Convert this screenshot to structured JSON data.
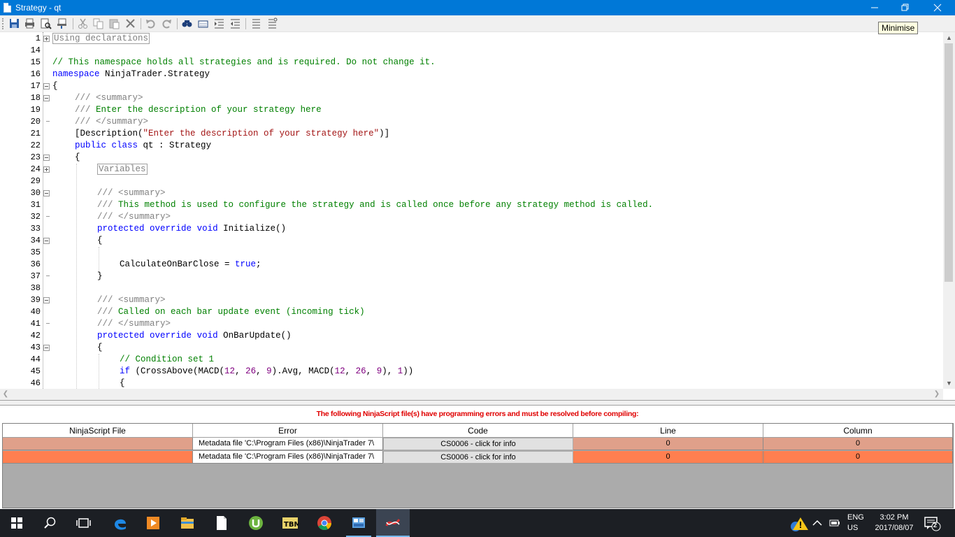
{
  "window": {
    "title": "Strategy - qt"
  },
  "tooltip": "Minimise",
  "toolbar": {
    "icons": [
      "save-icon",
      "print-icon",
      "print-preview-icon",
      "page-setup-icon",
      "cut-icon",
      "copy-icon",
      "paste-icon",
      "delete-icon",
      "undo-icon",
      "redo-icon",
      "find-icon",
      "replace-icon",
      "indent-icon",
      "outdent-icon",
      "comment-icon",
      "uncomment-icon"
    ]
  },
  "editor": {
    "line_numbers": [
      "1",
      "14",
      "15",
      "16",
      "17",
      "18",
      "19",
      "20",
      "21",
      "22",
      "23",
      "24",
      "29",
      "30",
      "31",
      "32",
      "33",
      "34",
      "35",
      "36",
      "37",
      "38",
      "39",
      "40",
      "41",
      "42",
      "43",
      "44",
      "45",
      "46"
    ],
    "region_using": "Using declarations",
    "region_variables": "Variables",
    "line15": "// This namespace holds all strategies and is required. Do not change it.",
    "kw_namespace": "namespace",
    "ns_name": " NinjaTrader.Strategy",
    "brace_open": "{",
    "brace_close": "}",
    "doc_summary_open": "/// <summary>",
    "doc_slashes": "/// ",
    "line19_text": "Enter the description of your strategy here",
    "doc_summary_close": "/// </summary>",
    "line21_a": "[Description(",
    "line21_str": "\"Enter the description of your strategy here\"",
    "line21_b": ")]",
    "kw_public": "public",
    "kw_class": "class",
    "class_decl": " qt : Strategy",
    "line31_text": "This method is used to configure the strategy and is called once before any strategy method is called.",
    "kw_protected": "protected",
    "kw_override": "override",
    "kw_void": "void",
    "method_init": " Initialize()",
    "line36_a": "CalculateOnBarClose = ",
    "kw_true": "true",
    "semicolon": ";",
    "line40_text": "Called on each bar update event (incoming tick)",
    "method_update": " OnBarUpdate()",
    "line44": "// Condition set 1",
    "kw_if": "if",
    "line45_a": " (CrossAbove(MACD(",
    "n12": "12",
    "n26": "26",
    "n9": "9",
    "n1": "1",
    "comma": ", ",
    "line45_b": ").Avg, MACD(",
    "close_paren": ")",
    "line45_end": "))"
  },
  "errors": {
    "message": "The following NinjaScript file(s) have programming errors and must be resolved before compiling:",
    "columns": [
      "NinjaScript File",
      "Error",
      "Code",
      "Line",
      "Column"
    ],
    "rows": [
      {
        "file": "",
        "error": "Metadata file 'C:\\Program Files (x86)\\NinjaTrader 7\\",
        "code": "CS0006 - click for info",
        "line": "0",
        "column": "0",
        "color": "#e0a08a"
      },
      {
        "file": "",
        "error": "Metadata file 'C:\\Program Files (x86)\\NinjaTrader 7\\",
        "code": "CS0006 - click for info",
        "line": "0",
        "column": "0",
        "color": "#ff7f50"
      }
    ]
  },
  "taskbar": {
    "apps": [
      "start-icon",
      "search-icon",
      "task-view-icon",
      "edge-icon",
      "media-player-icon",
      "file-explorer-icon",
      "document-icon",
      "utorrent-icon",
      "tbm-icon",
      "chrome-icon",
      "control-panel-icon",
      "ninjatrader-icon"
    ],
    "lang_1": "ENG",
    "lang_2": "US",
    "time": "3:02 PM",
    "date": "2017/08/07",
    "notifications": "2"
  },
  "colors": {
    "titlebar": "#0078d7",
    "keyword": "#0000ff",
    "comment": "#008000",
    "string": "#a31515",
    "number": "#800080",
    "error_text": "#e00000"
  }
}
